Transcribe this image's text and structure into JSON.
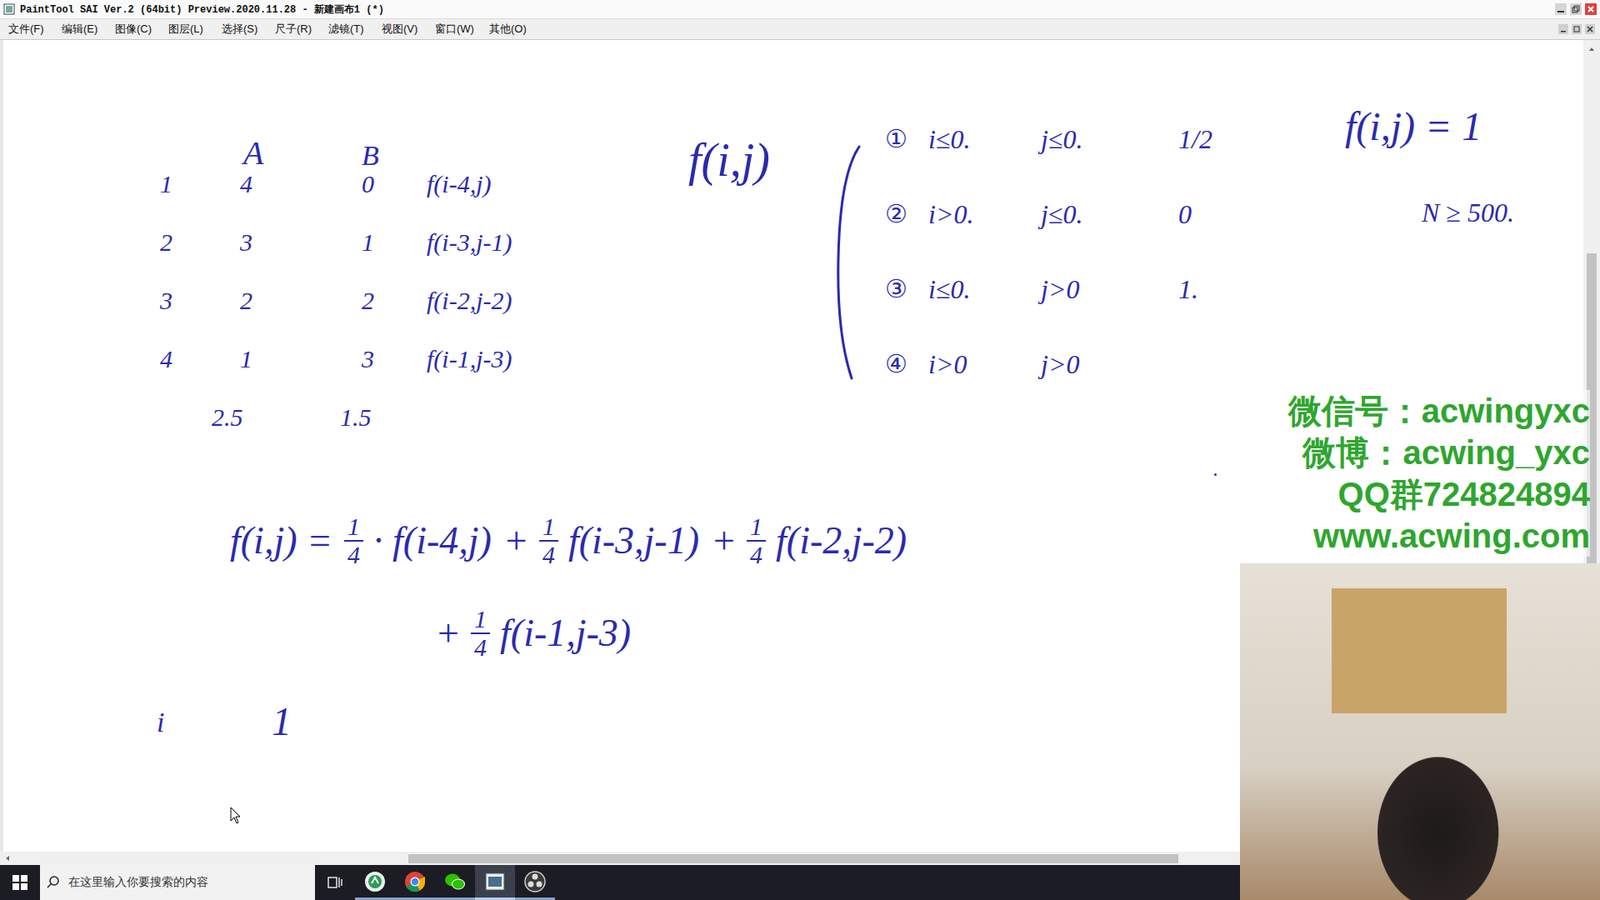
{
  "window": {
    "title": "PaintTool SAI Ver.2 (64bit) Preview.2020.11.28 - 新建画布1 (*)"
  },
  "menu": [
    "文件(F)",
    "编辑(E)",
    "图像(C)",
    "图层(L)",
    "选择(S)",
    "尺子(R)",
    "滤镜(T)",
    "视图(V)",
    "窗口(W)",
    "其他(O)"
  ],
  "canvas": {
    "table": {
      "headers": [
        "A",
        "B"
      ],
      "rows": [
        {
          "n": "1",
          "a": "4",
          "b": "0",
          "f": "f(i-4,j)"
        },
        {
          "n": "2",
          "a": "3",
          "b": "1",
          "f": "f(i-3,j-1)"
        },
        {
          "n": "3",
          "a": "2",
          "b": "2",
          "f": "f(i-2,j-2)"
        },
        {
          "n": "4",
          "a": "1",
          "b": "3",
          "f": "f(i-1,j-3)"
        }
      ],
      "summary": [
        "2.5",
        "1.5"
      ]
    },
    "definition": "f(i,j)",
    "cases": [
      {
        "mark": "①",
        "i": "i≤0.",
        "j": "j≤0.",
        "value": "1/2"
      },
      {
        "mark": "②",
        "i": "i>0.",
        "j": "j≤0.",
        "value": "0"
      },
      {
        "mark": "③",
        "i": "i≤0.",
        "j": "j>0",
        "value": "1."
      },
      {
        "mark": "④",
        "i": "i>0",
        "j": "j>0"
      }
    ],
    "note": {
      "formula": "f(i,j) = 1",
      "bound": "N ≥ 500."
    },
    "equation": {
      "lhs": "f(i,j) =",
      "lines": [
        [
          {
            "num": "1",
            "den": "4",
            "expr": "· f(i-4,j)"
          },
          {
            "sign": "+",
            "num": "1",
            "den": "4",
            "expr": "f(i-3,j-1)"
          },
          {
            "sign": "+",
            "num": "1",
            "den": "4",
            "expr": "f(i-2,j-2)"
          }
        ],
        [
          {
            "sign": "+",
            "num": "1",
            "den": "4",
            "expr": "f(i-1,j-3)"
          }
        ]
      ]
    },
    "scribble": [
      "i",
      "1"
    ]
  },
  "watermark": [
    "微信号：acwingyxc",
    "微博：acwing_yxc",
    "QQ群724824894",
    "www.acwing.com"
  ],
  "taskbar": {
    "search": {
      "placeholder": "在这里输入你要搜索的内容"
    },
    "apps": [
      {
        "kind": "acwing",
        "active": false
      },
      {
        "kind": "chrome",
        "active": false
      },
      {
        "kind": "wechat",
        "active": false
      },
      {
        "kind": "sai",
        "active": true
      },
      {
        "kind": "obs",
        "active": false
      }
    ]
  }
}
